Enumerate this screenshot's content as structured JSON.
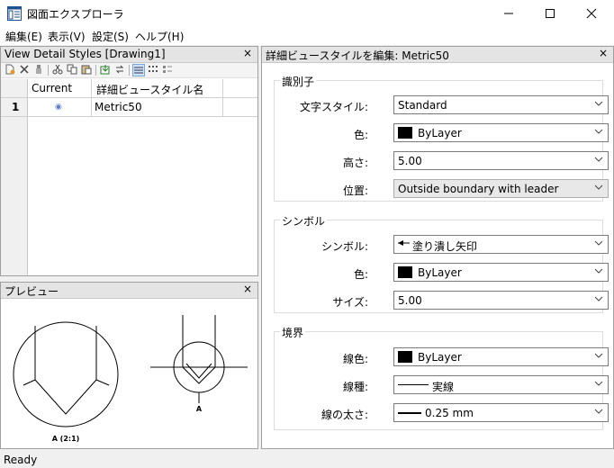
{
  "window": {
    "title": "図面エクスプローラ",
    "min": "—",
    "max": "☐",
    "close": "✕"
  },
  "menu": [
    "編集(E)",
    "表示(V)",
    "設定(S)",
    "ヘルプ(H)"
  ],
  "styles_pane": {
    "title": "View Detail Styles [Drawing1]",
    "close": "×",
    "columns": [
      "Current",
      "詳細ビュースタイル名"
    ],
    "rows": [
      {
        "num": "1",
        "current": "◉",
        "name": "Metric50"
      }
    ]
  },
  "preview_pane": {
    "title": "プレビュー",
    "close": "×",
    "label_large": "A (2:1)",
    "label_small": "A"
  },
  "editor_pane": {
    "title": "詳細ビュースタイルを編集: Metric50",
    "close": "×",
    "groups": {
      "identifier": {
        "title": "識別子",
        "fields": [
          {
            "label": "文字スタイル:",
            "value": "Standard"
          },
          {
            "label": "色:",
            "value": "ByLayer"
          },
          {
            "label": "高さ:",
            "value": "5.00"
          },
          {
            "label": "位置:",
            "value": "Outside boundary with leader"
          }
        ]
      },
      "symbol": {
        "title": "シンボル",
        "fields": [
          {
            "label": "シンボル:",
            "value": "塗り潰し矢印"
          },
          {
            "label": "色:",
            "value": "ByLayer"
          },
          {
            "label": "サイズ:",
            "value": "5.00"
          }
        ]
      },
      "boundary": {
        "title": "境界",
        "fields": [
          {
            "label": "線色:",
            "value": "ByLayer"
          },
          {
            "label": "線種:",
            "value": "実線"
          },
          {
            "label": "線の太さ:",
            "value": "0.25 mm"
          }
        ]
      }
    }
  },
  "status": {
    "text": "Ready"
  }
}
